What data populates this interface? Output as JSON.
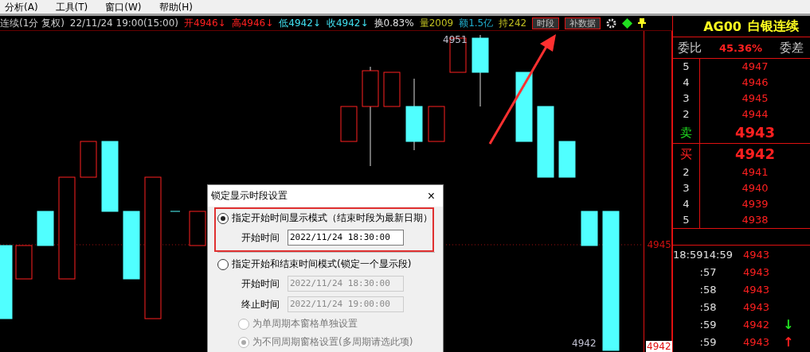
{
  "menu": [
    {
      "label": "分析(A)"
    },
    {
      "label": "工具(T)"
    },
    {
      "label": "窗口(W)"
    },
    {
      "label": "帮助(H)"
    }
  ],
  "quote_bar": {
    "title": "连续(1分 复权)",
    "datetime": "22/11/24 19:00(15:00)",
    "fields": [
      {
        "label": "开",
        "value": "4946",
        "arrow": "↓",
        "color": "#ff2020"
      },
      {
        "label": "高",
        "value": "4946",
        "arrow": "↓",
        "color": "#ff2020"
      },
      {
        "label": "低",
        "value": "4942",
        "arrow": "↓",
        "color": "#40e0f0"
      },
      {
        "label": "收",
        "value": "4942",
        "arrow": "↓",
        "color": "#40e0f0"
      },
      {
        "label": "换",
        "value": "0.83%",
        "color": "#e0e0e0"
      },
      {
        "label": "量",
        "value": "2009",
        "color": "#c0c020"
      },
      {
        "label": "额",
        "value": "1.5亿",
        "color": "#20b0d0"
      },
      {
        "label": "持",
        "value": "242",
        "color": "#c0c020"
      }
    ],
    "buttons": [
      {
        "label": "时段"
      },
      {
        "label": "补数据"
      }
    ]
  },
  "chart": {
    "price_labels": [
      {
        "text": "4951"
      },
      {
        "text": "4942"
      }
    ],
    "axis_labels": [
      {
        "text": "4945",
        "kind": "line"
      },
      {
        "text": "4942",
        "kind": "tag"
      }
    ]
  },
  "dialog": {
    "title": "锁定显示时段设置",
    "close": "×",
    "options": [
      {
        "label": "指定开始时间显示模式（结束时段为最新日期）",
        "selected": true,
        "fields": [
          {
            "label": "开始时间",
            "value": "2022/11/24 18:30:00",
            "disabled": false
          }
        ]
      },
      {
        "label": "指定开始和结束时间模式(锁定一个显示段)",
        "selected": false,
        "fields": [
          {
            "label": "开始时间",
            "value": "2022/11/24 18:30:00",
            "disabled": true
          },
          {
            "label": "终止时间",
            "value": "2022/11/24 19:00:00",
            "disabled": true
          }
        ]
      }
    ],
    "sub_options": [
      {
        "label": "为单周期本窗格单独设置",
        "selected": false,
        "disabled": true
      },
      {
        "label": "为不同周期窗格设置(多周期请选此项)",
        "selected": true,
        "disabled": true
      }
    ]
  },
  "panel": {
    "symbol": "AG00",
    "name": "白银连续",
    "ratio_label": "委比",
    "ratio": "45.36%",
    "diff_label": "委差",
    "asks": [
      {
        "level": "5",
        "price": "4947",
        "best": false
      },
      {
        "level": "4",
        "price": "4946",
        "best": false
      },
      {
        "level": "3",
        "price": "4945",
        "best": false
      },
      {
        "level": "2",
        "price": "4944",
        "best": false
      },
      {
        "level": "卖",
        "price": "4943",
        "best": true
      }
    ],
    "bids": [
      {
        "level": "买",
        "price": "4942",
        "best": true
      },
      {
        "level": "2",
        "price": "4941",
        "best": false
      },
      {
        "level": "3",
        "price": "4940",
        "best": false
      },
      {
        "level": "4",
        "price": "4939",
        "best": false
      },
      {
        "level": "5",
        "price": "4938",
        "best": false
      }
    ],
    "ticks": [
      {
        "time": "18:59",
        "extra": "14:59",
        "price": "4943"
      },
      {
        "time": ":57",
        "price": "4943"
      },
      {
        "time": ":58",
        "price": "4943"
      },
      {
        "time": ":58",
        "price": "4943"
      },
      {
        "time": ":59",
        "price": "4942",
        "arrow": "↓",
        "color": "#20e020"
      },
      {
        "time": ":59",
        "price": "4943",
        "arrow": "↑",
        "color": "#ff2020"
      }
    ]
  }
}
